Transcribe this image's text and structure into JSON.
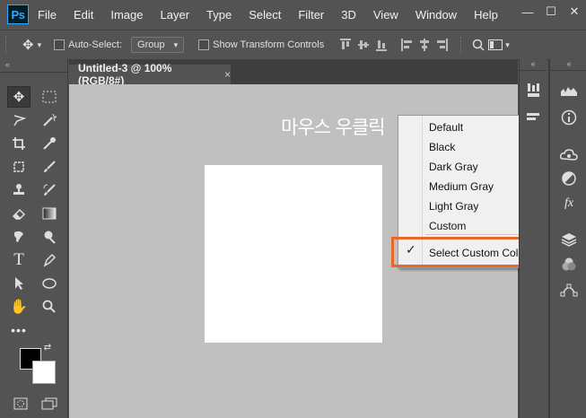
{
  "app": {
    "logo_text": "Ps"
  },
  "menubar": {
    "items": [
      "File",
      "Edit",
      "Image",
      "Layer",
      "Type",
      "Select",
      "Filter",
      "3D",
      "View",
      "Window",
      "Help"
    ],
    "window_controls": [
      "—",
      "☐",
      "✕"
    ]
  },
  "options_bar": {
    "auto_select_label": "Auto-Select:",
    "group_value": "Group",
    "transform_controls_label": "Show Transform Controls"
  },
  "document": {
    "tab_title": "Untitled-3 @ 100% (RGB/8#)",
    "tab_close": "×",
    "annotation": "마우스 우클릭"
  },
  "context_menu": {
    "items": [
      "Default",
      "Black",
      "Dark Gray",
      "Medium Gray",
      "Light Gray",
      "Custom"
    ],
    "selected_item": "Select Custom Color...",
    "check_mark": "✓",
    "highlight_color": "#e8682c"
  },
  "icons": {
    "left_toolbar": [
      "move-icon",
      "marquee-icon",
      "lasso-icon",
      "magic-wand-icon",
      "crop-icon",
      "eyedropper-icon",
      "frame-icon",
      "brush-icon",
      "stamp-icon",
      "history-brush-icon",
      "eraser-icon",
      "gradient-icon",
      "smudge-icon",
      "dodge-icon",
      "type-icon",
      "pen-icon",
      "path-select-icon",
      "ellipse-icon",
      "hand-icon",
      "zoom-icon",
      "more-icon"
    ],
    "panel_col1": [
      "brush-settings-icon",
      "clone-source-icon"
    ],
    "panel_col2": [
      "histogram-icon",
      "info-icon",
      "libraries-icon",
      "adjustments-icon",
      "styles-icon",
      "layers-icon",
      "channels-icon",
      "paths-icon"
    ]
  }
}
